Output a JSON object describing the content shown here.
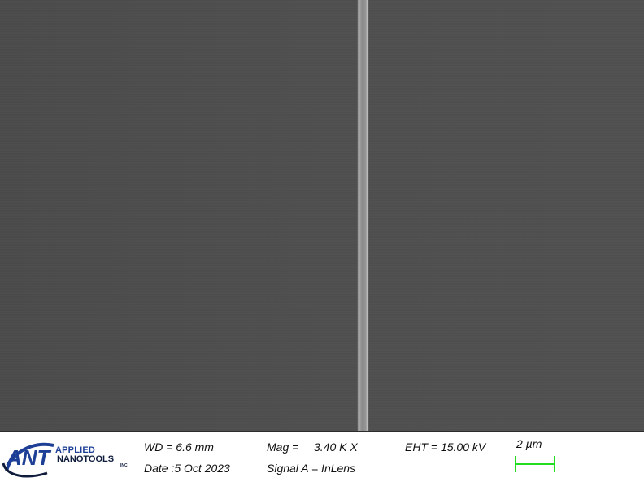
{
  "image": {
    "description_label": "SEM micrograph"
  },
  "logo": {
    "mark": "ANT",
    "line1": "APPLIED",
    "line2": "NANOTOOLS",
    "line3": "INC."
  },
  "info": {
    "wd": "WD =  6.6 mm",
    "mag_label": "Mag =",
    "mag_value": "3.40 K X",
    "eht": "EHT = 15.00 kV",
    "date": "Date :5 Oct 2023",
    "signal": "Signal A = InLens"
  },
  "scalebar": {
    "label": "2 µm",
    "color": "#22dd22"
  },
  "colors": {
    "logo_blue": "#1e3f96",
    "logo_navy": "#101c3c"
  }
}
